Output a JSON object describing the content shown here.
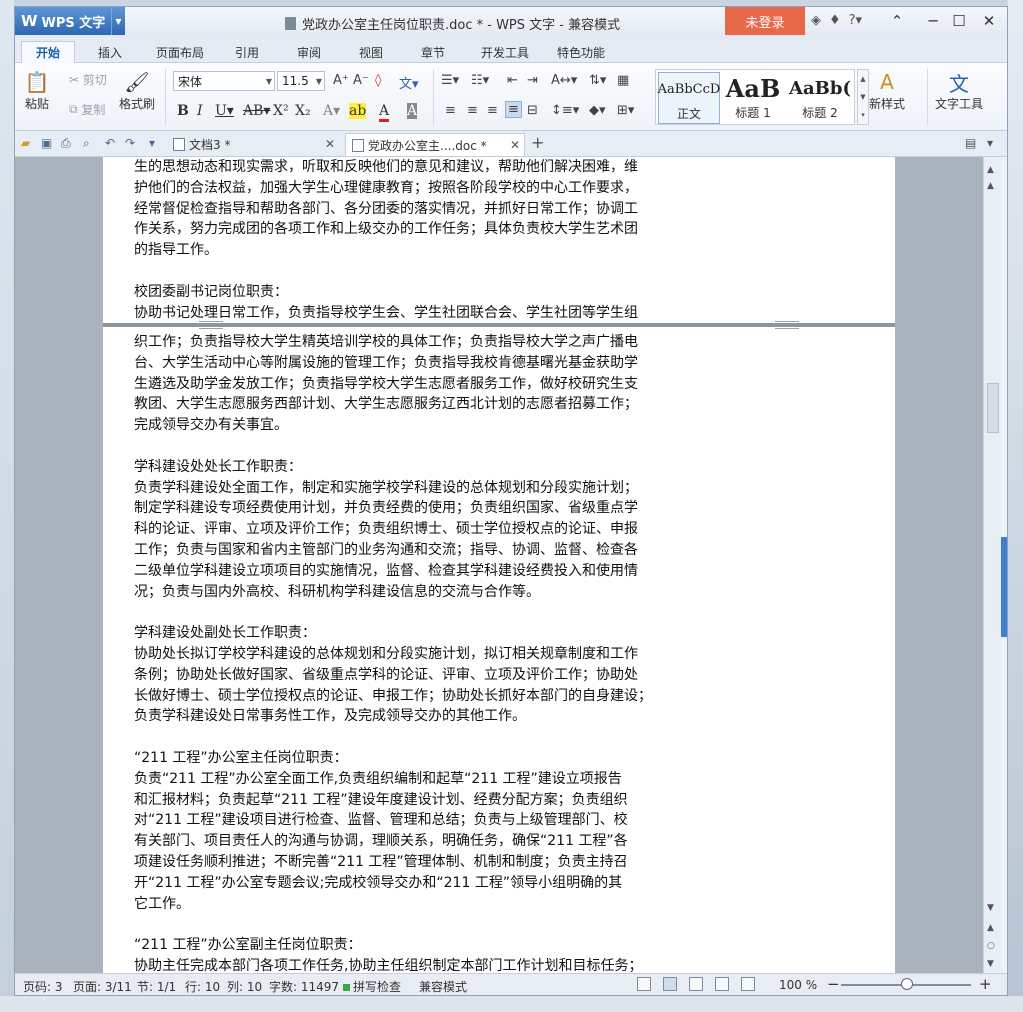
{
  "app": {
    "name": "WPS 文字",
    "window_title": "党政办公室主任岗位职责.doc * - WPS 文字 - 兼容模式",
    "login_label": "未登录"
  },
  "tabs": [
    "开始",
    "插入",
    "页面布局",
    "引用",
    "审阅",
    "视图",
    "章节",
    "开发工具",
    "特色功能"
  ],
  "ribbon": {
    "paste": "粘贴",
    "cut": "剪切",
    "copy": "复制",
    "format_painter": "格式刷",
    "font_name": "宋体",
    "font_size": "11.5",
    "styles": [
      {
        "sample": "AaBbCcD",
        "label": "正文"
      },
      {
        "sample": "AaB",
        "label": "标题 1"
      },
      {
        "sample": "AaBb(",
        "label": "标题 2"
      }
    ],
    "new_style": "新样式",
    "text_tools": "文字工具"
  },
  "doc_tabs": [
    {
      "label": "文档3 *",
      "active": false
    },
    {
      "label": "党政办公室主....doc *",
      "active": true
    }
  ],
  "page1_lines": [
    "生的思想动态和现实需求，听取和反映他们的意见和建议，帮助他们解决困难，维",
    "护他们的合法权益，加强大学生心理健康教育；按照各阶段学校的中心工作要求，",
    "经常督促检查指导和帮助各部门、各分团委的落实情况，并抓好日常工作；协调工",
    "作关系，努力完成团的各项工作和上级交办的工作任务；具体负责校大学生艺术团",
    "的指导工作。",
    "",
    "校团委副书记岗位职责：",
    "协助书记处理日常工作，负责指导校学生会、学生社团联合会、学生社团等学生组"
  ],
  "page2_lines": [
    "织工作；负责指导校大学生精英培训学校的具体工作；负责指导校大学之声广播电",
    "台、大学生活动中心等附属设施的管理工作；负责指导我校肯德基曙光基金获助学",
    "生遴选及助学金发放工作；负责指导学校大学生志愿者服务工作，做好校研究生支",
    "教团、大学生志愿服务西部计划、大学生志愿服务辽西北计划的志愿者招募工作；",
    "完成领导交办有关事宜。",
    "",
    "学科建设处处长工作职责：",
    "负责学科建设处全面工作，制定和实施学校学科建设的总体规划和分段实施计划；",
    "制定学科建设专项经费使用计划，并负责经费的使用；负责组织国家、省级重点学",
    "科的论证、评审、立项及评价工作；负责组织博士、硕士学位授权点的论证、申报",
    "工作；负责与国家和省内主管部门的业务沟通和交流；指导、协调、监督、检查各",
    "二级单位学科建设立项项目的实施情况，监督、检查其学科建设经费投入和使用情",
    "况；负责与国内外高校、科研机构学科建设信息的交流与合作等。",
    "",
    "学科建设处副处长工作职责：",
    "协助处长拟订学校学科建设的总体规划和分段实施计划，拟订相关规章制度和工作",
    "条例；协助处长做好国家、省级重点学科的论证、评审、立项及评价工作；协助处",
    "长做好博士、硕士学位授权点的论证、申报工作；协助处长抓好本部门的自身建设；",
    "负责学科建设处日常事务性工作，及完成领导交办的其他工作。",
    "",
    "“211 工程”办公室主任岗位职责：",
    "负责“211 工程”办公室全面工作,负责组织编制和起草“211 工程”建设立项报告",
    "和汇报材料；负责起草“211 工程”建设年度建设计划、经费分配方案；负责组织",
    "对“211 工程”建设项目进行检查、监督、管理和总结；负责与上级管理部门、校",
    "有关部门、项目责任人的沟通与协调，理顺关系，明确任务，确保“211 工程”各",
    "项建设任务顺利推进；不断完善“211 工程”管理体制、机制和制度；负责主持召",
    "开“211 工程”办公室专题会议;完成校领导交办和“211 工程”领导小组明确的其",
    "它工作。",
    "",
    "“211 工程”办公室副主任岗位职责：",
    "协助主任完成本部门各项工作任务,协助主任组织制定本部门工作计划和目标任务；"
  ],
  "status": {
    "page_code": "页码: 3",
    "page": "页面: 3/11",
    "section": "节: 1/1",
    "row": "行: 10",
    "col": "列: 10",
    "word_count": "字数: 11497",
    "spell_check": "拼写检查",
    "compat_mode": "兼容模式",
    "zoom": "100 %"
  }
}
